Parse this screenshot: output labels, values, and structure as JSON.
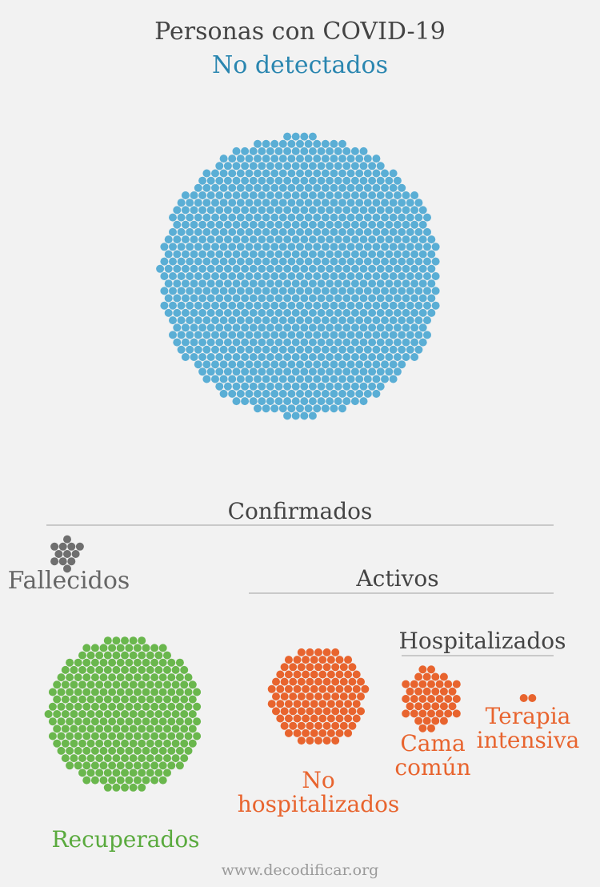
{
  "title": "Personas con COVID-19",
  "labels": {
    "no_detectados": "No detectados",
    "confirmados": "Confirmados",
    "fallecidos": "Fallecidos",
    "activos": "Activos",
    "hospitalizados": "Hospitalizados",
    "recuperados": "Recuperados",
    "no_hospitalizados_1": "No",
    "no_hospitalizados_2": "hospitalizados",
    "cama_comun_1": "Cama",
    "cama_comun_2": "común",
    "terapia_intensiva_1": "Terapia",
    "terapia_intensiva_2": "intensiva"
  },
  "source": "www.decodificar.org",
  "colors": {
    "no_detectados": "#5aaed5",
    "fallecidos": "#6f6f6f",
    "recuperados": "#6ab74d",
    "activos": "#e8642e"
  },
  "chart_data": {
    "type": "packed-dot-clusters",
    "unit": "1 dot = same number of people in every group",
    "groups": [
      {
        "key": "no_detectados",
        "dots": 1000
      },
      {
        "key": "fallecidos",
        "dots": 12
      },
      {
        "key": "recuperados",
        "dots": 300
      },
      {
        "key": "no_hospitalizados",
        "dots": 120
      },
      {
        "key": "cama_comun",
        "dots": 45
      },
      {
        "key": "terapia_intensiva",
        "dots": 2
      }
    ]
  }
}
